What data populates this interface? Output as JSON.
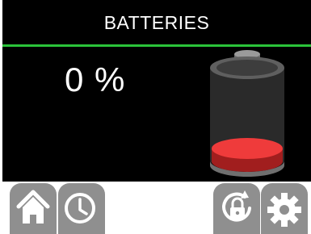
{
  "header": {
    "title": "BATTERIES"
  },
  "battery": {
    "level_text": "0 %",
    "charge_level": 0
  },
  "colors": {
    "accent_line": "#2bc33a",
    "battery_fill": "#ef3b3b",
    "button_bg": "#8f8f8f"
  },
  "toolbar": {
    "icons": [
      "home-icon",
      "clock-icon",
      "lock-rotate-icon",
      "gear-icon"
    ]
  }
}
